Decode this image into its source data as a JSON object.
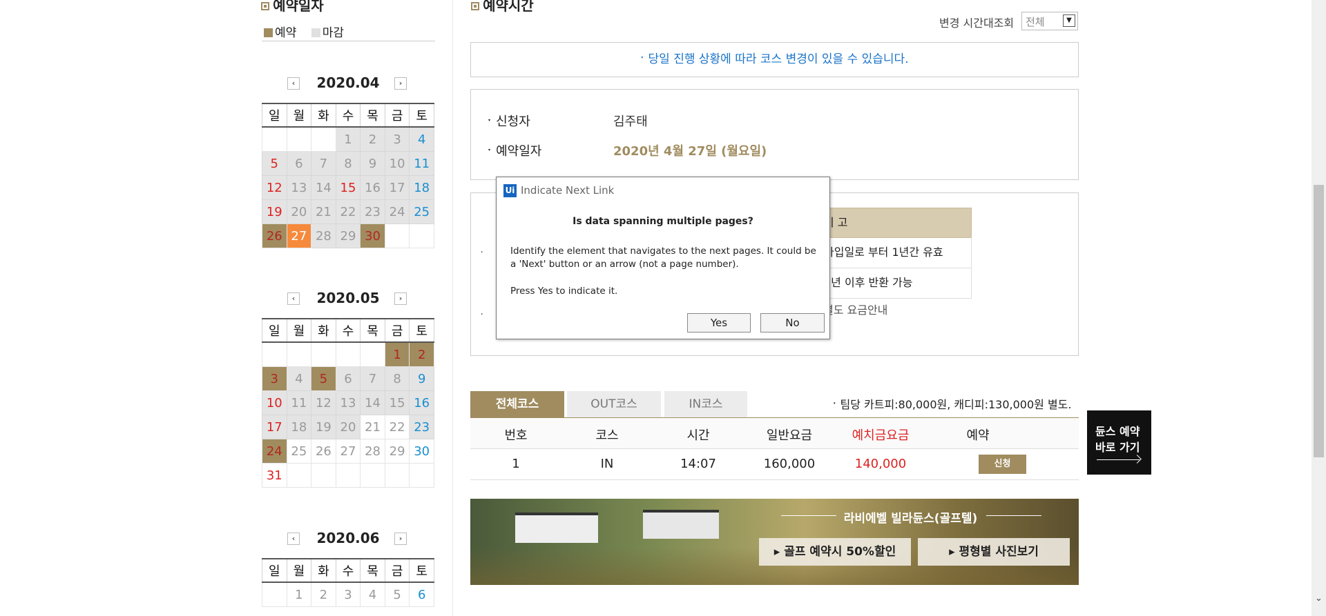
{
  "left": {
    "section_title": "예약일자",
    "legend": [
      {
        "label": "예약",
        "color": "#a08c5f"
      },
      {
        "label": "마감",
        "color": "#e0e0e0"
      }
    ],
    "weekdays": [
      "일",
      "월",
      "화",
      "수",
      "목",
      "금",
      "토"
    ],
    "months": [
      {
        "title": "2020.04",
        "rows": [
          [
            {
              "v": "",
              "c": ""
            },
            {
              "v": "",
              "c": ""
            },
            {
              "v": "",
              "c": ""
            },
            {
              "v": "1",
              "c": "g"
            },
            {
              "v": "2",
              "c": "g"
            },
            {
              "v": "3",
              "c": "g"
            },
            {
              "v": "4",
              "c": "g blue"
            }
          ],
          [
            {
              "v": "5",
              "c": "g red"
            },
            {
              "v": "6",
              "c": "g"
            },
            {
              "v": "7",
              "c": "g"
            },
            {
              "v": "8",
              "c": "g"
            },
            {
              "v": "9",
              "c": "g"
            },
            {
              "v": "10",
              "c": "g"
            },
            {
              "v": "11",
              "c": "g blue"
            }
          ],
          [
            {
              "v": "12",
              "c": "g red"
            },
            {
              "v": "13",
              "c": "g"
            },
            {
              "v": "14",
              "c": "g"
            },
            {
              "v": "15",
              "c": "g red"
            },
            {
              "v": "16",
              "c": "g"
            },
            {
              "v": "17",
              "c": "g"
            },
            {
              "v": "18",
              "c": "g blue"
            }
          ],
          [
            {
              "v": "19",
              "c": "g red"
            },
            {
              "v": "20",
              "c": "g"
            },
            {
              "v": "21",
              "c": "g"
            },
            {
              "v": "22",
              "c": "g"
            },
            {
              "v": "23",
              "c": "g"
            },
            {
              "v": "24",
              "c": "g"
            },
            {
              "v": "25",
              "c": "g blue"
            }
          ],
          [
            {
              "v": "26",
              "c": "r red"
            },
            {
              "v": "27",
              "c": "t"
            },
            {
              "v": "28",
              "c": "g"
            },
            {
              "v": "29",
              "c": "g"
            },
            {
              "v": "30",
              "c": "r red"
            },
            {
              "v": "",
              "c": ""
            },
            {
              "v": "",
              "c": ""
            }
          ]
        ]
      },
      {
        "title": "2020.05",
        "rows": [
          [
            {
              "v": "",
              "c": ""
            },
            {
              "v": "",
              "c": ""
            },
            {
              "v": "",
              "c": ""
            },
            {
              "v": "",
              "c": ""
            },
            {
              "v": "",
              "c": ""
            },
            {
              "v": "1",
              "c": "r red"
            },
            {
              "v": "2",
              "c": "r red"
            }
          ],
          [
            {
              "v": "3",
              "c": "r red"
            },
            {
              "v": "4",
              "c": "g"
            },
            {
              "v": "5",
              "c": "r red"
            },
            {
              "v": "6",
              "c": "g"
            },
            {
              "v": "7",
              "c": "g"
            },
            {
              "v": "8",
              "c": "g"
            },
            {
              "v": "9",
              "c": "g blue"
            }
          ],
          [
            {
              "v": "10",
              "c": "g red"
            },
            {
              "v": "11",
              "c": "g"
            },
            {
              "v": "12",
              "c": "g"
            },
            {
              "v": "13",
              "c": "g"
            },
            {
              "v": "14",
              "c": "g"
            },
            {
              "v": "15",
              "c": "g"
            },
            {
              "v": "16",
              "c": "g blue"
            }
          ],
          [
            {
              "v": "17",
              "c": "g red"
            },
            {
              "v": "18",
              "c": "g"
            },
            {
              "v": "19",
              "c": "g"
            },
            {
              "v": "20",
              "c": "g"
            },
            {
              "v": "21",
              "c": ""
            },
            {
              "v": "22",
              "c": ""
            },
            {
              "v": "23",
              "c": "g blue"
            }
          ],
          [
            {
              "v": "24",
              "c": "r red"
            },
            {
              "v": "25",
              "c": ""
            },
            {
              "v": "26",
              "c": ""
            },
            {
              "v": "27",
              "c": ""
            },
            {
              "v": "28",
              "c": ""
            },
            {
              "v": "29",
              "c": ""
            },
            {
              "v": "30",
              "c": "blue"
            }
          ],
          [
            {
              "v": "31",
              "c": "red"
            },
            {
              "v": "",
              "c": ""
            },
            {
              "v": "",
              "c": ""
            },
            {
              "v": "",
              "c": ""
            },
            {
              "v": "",
              "c": ""
            },
            {
              "v": "",
              "c": ""
            },
            {
              "v": "",
              "c": ""
            }
          ]
        ]
      },
      {
        "title": "2020.06",
        "rows": [
          [
            {
              "v": "",
              "c": ""
            },
            {
              "v": "1",
              "c": ""
            },
            {
              "v": "2",
              "c": ""
            },
            {
              "v": "3",
              "c": ""
            },
            {
              "v": "4",
              "c": ""
            },
            {
              "v": "5",
              "c": ""
            },
            {
              "v": "6",
              "c": "blue"
            }
          ]
        ]
      }
    ]
  },
  "right": {
    "section_title": "예약시간",
    "filter_label": "변경 시간대조회",
    "filter_value": "전체",
    "notice": "ˑ 당일 진행 상황에 따라 코스 변경이 있을 수 있습니다.",
    "applicant_label": "신청자",
    "applicant_value": "김주태",
    "date_label": "예약일자",
    "date_value": "2020년 4월 27일 (월요일)",
    "partial_header": "비 고",
    "partial_row1": "가입일로 부터 1년간 유효",
    "partial_row2": "1년 이후 반환 가능",
    "partial_note": "별도 요금안내",
    "tabs": [
      "전체코스",
      "OUT코스",
      "IN코스"
    ],
    "fee_note": "ˑ 팀당 카트피:80,000원, 캐디피:130,000원 별도.",
    "table_headers": [
      "번호",
      "코스",
      "시간",
      "일반요금",
      "예치금요금",
      "예약"
    ],
    "table_row": {
      "no": "1",
      "course": "IN",
      "time": "14:07",
      "regular": "160,000",
      "deposit": "140,000",
      "button": "신청"
    },
    "banner_title": "라비에벨 빌라듄스(골프텔)",
    "banner_btn1": "골프 예약시 50%할인",
    "banner_btn2": "평형별 사진보기",
    "dunes_text_1": "듄스 예약",
    "dunes_text_2": "바로 가기"
  },
  "dialog": {
    "app_icon": "Ui",
    "title": "Indicate Next Link",
    "heading": "Is data spanning multiple pages?",
    "body": "Identify the element that navigates to the next pages. It could be a 'Next' button or an arrow (not a page number).",
    "prompt": "Press Yes to indicate it.",
    "yes": "Yes",
    "no": "No"
  },
  "colors": {
    "accent": "#a08c5f",
    "today": "#f68a3c",
    "blue": "#1a8fd1",
    "red": "#d22"
  }
}
